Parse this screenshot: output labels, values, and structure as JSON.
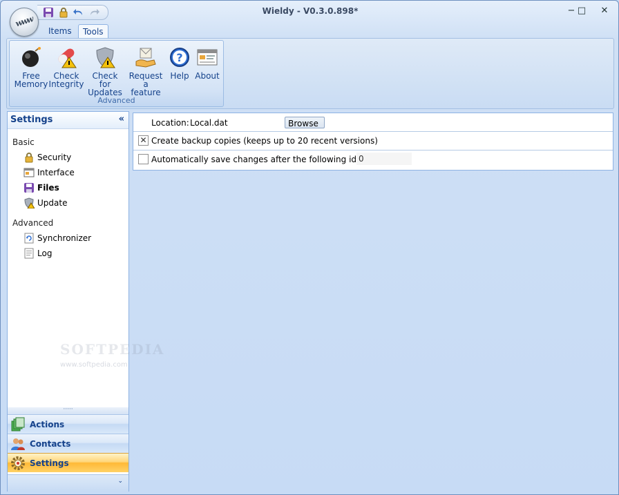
{
  "window": {
    "title": "Wieldy - V0.3.0.898*",
    "controls": {
      "minimize": "−",
      "maximize": "□",
      "close": "✕"
    }
  },
  "quick_access": [
    "save-icon",
    "lock-icon",
    "undo-icon",
    "redo-icon"
  ],
  "tabs": [
    {
      "label": "Items",
      "active": false
    },
    {
      "label": "Tools",
      "active": true
    }
  ],
  "ribbon": {
    "group_label": "Advanced",
    "buttons": [
      {
        "label": "Free\nMemory",
        "icon": "bomb-icon"
      },
      {
        "label": "Check\nIntegrity",
        "icon": "pill-warning-icon"
      },
      {
        "label": "Check for\nUpdates",
        "icon": "shield-warning-icon"
      },
      {
        "label": "Request a\nfeature",
        "icon": "request-feature-icon"
      },
      {
        "label": "Help",
        "icon": "help-icon"
      },
      {
        "label": "About",
        "icon": "about-window-icon"
      }
    ]
  },
  "sidebar": {
    "title": "Settings",
    "collapse": "«",
    "sections": [
      {
        "label": "Basic",
        "items": [
          {
            "label": "Security",
            "icon": "lock-icon",
            "selected": false
          },
          {
            "label": "Interface",
            "icon": "window-icon",
            "selected": false
          },
          {
            "label": "Files",
            "icon": "floppy-icon",
            "selected": true
          },
          {
            "label": "Update",
            "icon": "shield-icon",
            "selected": false
          }
        ]
      },
      {
        "label": "Advanced",
        "items": [
          {
            "label": "Synchronizer",
            "icon": "sync-icon",
            "selected": false
          },
          {
            "label": "Log",
            "icon": "log-icon",
            "selected": false
          }
        ]
      }
    ],
    "splitter": "·····",
    "nav_buttons": [
      {
        "label": "Actions",
        "icon": "actions-icon",
        "active": false
      },
      {
        "label": "Contacts",
        "icon": "contacts-icon",
        "active": false
      },
      {
        "label": "Settings",
        "icon": "settings-gear-icon",
        "active": true
      }
    ],
    "footer_arrow": "⌄"
  },
  "files_settings": {
    "location_label": "Location:",
    "location_value": "Local.dat",
    "browse_label": "Browse",
    "backup_label": "Create backup copies (keeps up to 20 recent versions)",
    "backup_checked": true,
    "autosave_label": "Automatically save changes after the following idle time:",
    "autosave_checked": false,
    "autosave_value": "0"
  },
  "watermark": {
    "text": "SOFTPEDIA",
    "sub": "www.softpedia.com"
  },
  "colors": {
    "accent": "#15428b",
    "nav_active": "#ffb936",
    "frame": "#c7dbf5"
  }
}
